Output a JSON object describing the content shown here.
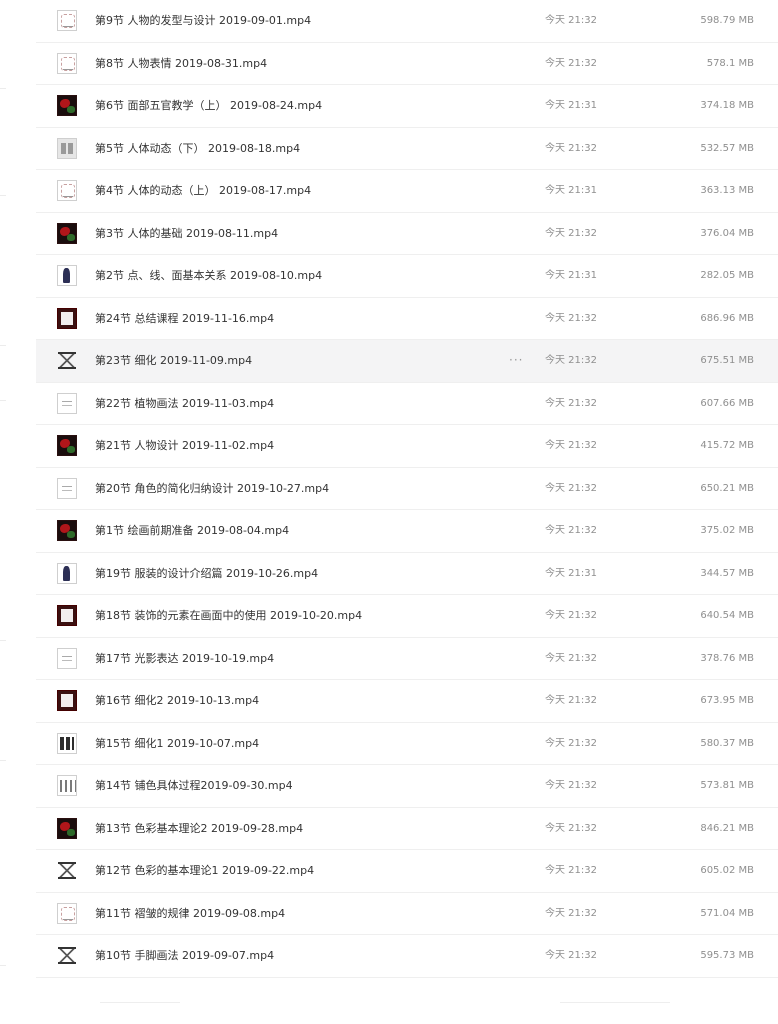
{
  "files": [
    {
      "name": "第9节 人物的发型与设计 2019-09-01.mp4",
      "time": "今天 21:32",
      "size": "598.79 MB",
      "thumb": "sketch"
    },
    {
      "name": "第8节 人物表情 2019-08-31.mp4",
      "time": "今天 21:32",
      "size": "578.1 MB",
      "thumb": "sketch"
    },
    {
      "name": "第6节 面部五官教学（上） 2019-08-24.mp4",
      "time": "今天 21:31",
      "size": "374.18 MB",
      "thumb": "red"
    },
    {
      "name": "第5节 人体动态（下） 2019-08-18.mp4",
      "time": "今天 21:32",
      "size": "532.57 MB",
      "thumb": "panels"
    },
    {
      "name": "第4节 人体的动态（上） 2019-08-17.mp4",
      "time": "今天 21:31",
      "size": "363.13 MB",
      "thumb": "sketch"
    },
    {
      "name": "第3节 人体的基础 2019-08-11.mp4",
      "time": "今天 21:32",
      "size": "376.04 MB",
      "thumb": "red"
    },
    {
      "name": "第2节 点、线、面基本关系 2019-08-10.mp4",
      "time": "今天 21:31",
      "size": "282.05 MB",
      "thumb": "figure"
    },
    {
      "name": "第24节 总结课程 2019-11-16.mp4",
      "time": "今天 21:32",
      "size": "686.96 MB",
      "thumb": "dark-frame"
    },
    {
      "name": "第23节 细化 2019-11-09.mp4",
      "time": "今天 21:32",
      "size": "675.51 MB",
      "thumb": "hourglass",
      "more": "···",
      "hovered": true
    },
    {
      "name": "第22节 植物画法 2019-11-03.mp4",
      "time": "今天 21:32",
      "size": "607.66 MB",
      "thumb": "plain"
    },
    {
      "name": "第21节 人物设计 2019-11-02.mp4",
      "time": "今天 21:32",
      "size": "415.72 MB",
      "thumb": "red"
    },
    {
      "name": "第20节 角色的简化归纳设计 2019-10-27.mp4",
      "time": "今天 21:32",
      "size": "650.21 MB",
      "thumb": "plain"
    },
    {
      "name": "第1节 绘画前期准备 2019-08-04.mp4",
      "time": "今天 21:32",
      "size": "375.02 MB",
      "thumb": "red"
    },
    {
      "name": "第19节 服装的设计介绍篇 2019-10-26.mp4",
      "time": "今天 21:31",
      "size": "344.57 MB",
      "thumb": "figure"
    },
    {
      "name": "第18节 装饰的元素在画面中的使用 2019-10-20.mp4",
      "time": "今天 21:32",
      "size": "640.54 MB",
      "thumb": "dark-frame"
    },
    {
      "name": "第17节 光影表达 2019-10-19.mp4",
      "time": "今天 21:32",
      "size": "378.76 MB",
      "thumb": "plain"
    },
    {
      "name": "第16节 细化2 2019-10-13.mp4",
      "time": "今天 21:32",
      "size": "673.95 MB",
      "thumb": "dark-frame"
    },
    {
      "name": "第15节 细化1 2019-10-07.mp4",
      "time": "今天 21:32",
      "size": "580.37 MB",
      "thumb": "tiles"
    },
    {
      "name": "第14节 铺色具体过程2019-09-30.mp4",
      "time": "今天 21:32",
      "size": "573.81 MB",
      "thumb": "columns"
    },
    {
      "name": "第13节 色彩基本理论2 2019-09-28.mp4",
      "time": "今天 21:32",
      "size": "846.21 MB",
      "thumb": "red"
    },
    {
      "name": "第12节 色彩的基本理论1 2019-09-22.mp4",
      "time": "今天 21:32",
      "size": "605.02 MB",
      "thumb": "hourglass"
    },
    {
      "name": "第11节 褶皱的规律 2019-09-08.mp4",
      "time": "今天 21:32",
      "size": "571.04 MB",
      "thumb": "sketch"
    },
    {
      "name": "第10节 手脚画法 2019-09-07.mp4",
      "time": "今天 21:32",
      "size": "595.73 MB",
      "thumb": "hourglass"
    }
  ]
}
